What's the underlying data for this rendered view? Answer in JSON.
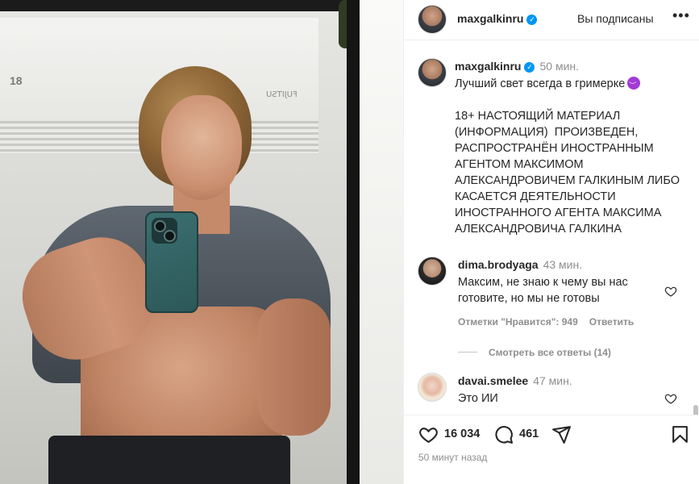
{
  "photo": {
    "ac_brand": "FUJITSU",
    "ac_display": "18"
  },
  "header": {
    "username": "maxgalkinru",
    "follow_status": "Вы подписаны",
    "more_label": "•••"
  },
  "caption": {
    "username": "maxgalkinru",
    "time": "50 мин.",
    "text_line1": "Лучший свет всегда в гримерке",
    "text_body": "18+ НАСТОЯЩИЙ МАТЕРИАЛ (ИНФОРМАЦИЯ)  ПРОИЗВЕДЕН, РАСПРОСТРАНЁН ИНОСТРАННЫМ АГЕНТОМ МАКСИМОМ АЛЕКСАНДРОВИЧЕМ ГАЛКИНЫМ ЛИБО КАСАЕТСЯ ДЕЯТЕЛЬНОСТИ ИНОСТРАННОГО АГЕНТА МАКСИМА АЛЕКСАНДРОВИЧА ГАЛКИНА"
  },
  "comments": [
    {
      "username": "dima.brodyaga",
      "time": "43 мин.",
      "text": "Максим, не знаю к чему вы нас готовите, но мы не готовы",
      "likes": "Отметки \"Нравится\": 949",
      "reply": "Ответить",
      "view_replies": "Смотреть все ответы (14)"
    },
    {
      "username": "davai.smelee",
      "time": "47 мин.",
      "text": "Это ИИ"
    }
  ],
  "actions": {
    "likes_count": "16 034",
    "comments_count": "461"
  },
  "footer": {
    "time_ago": "50 минут назад"
  },
  "colors": {
    "verified": "#0095f6",
    "text": "#262626",
    "muted": "#8e8e8e"
  }
}
